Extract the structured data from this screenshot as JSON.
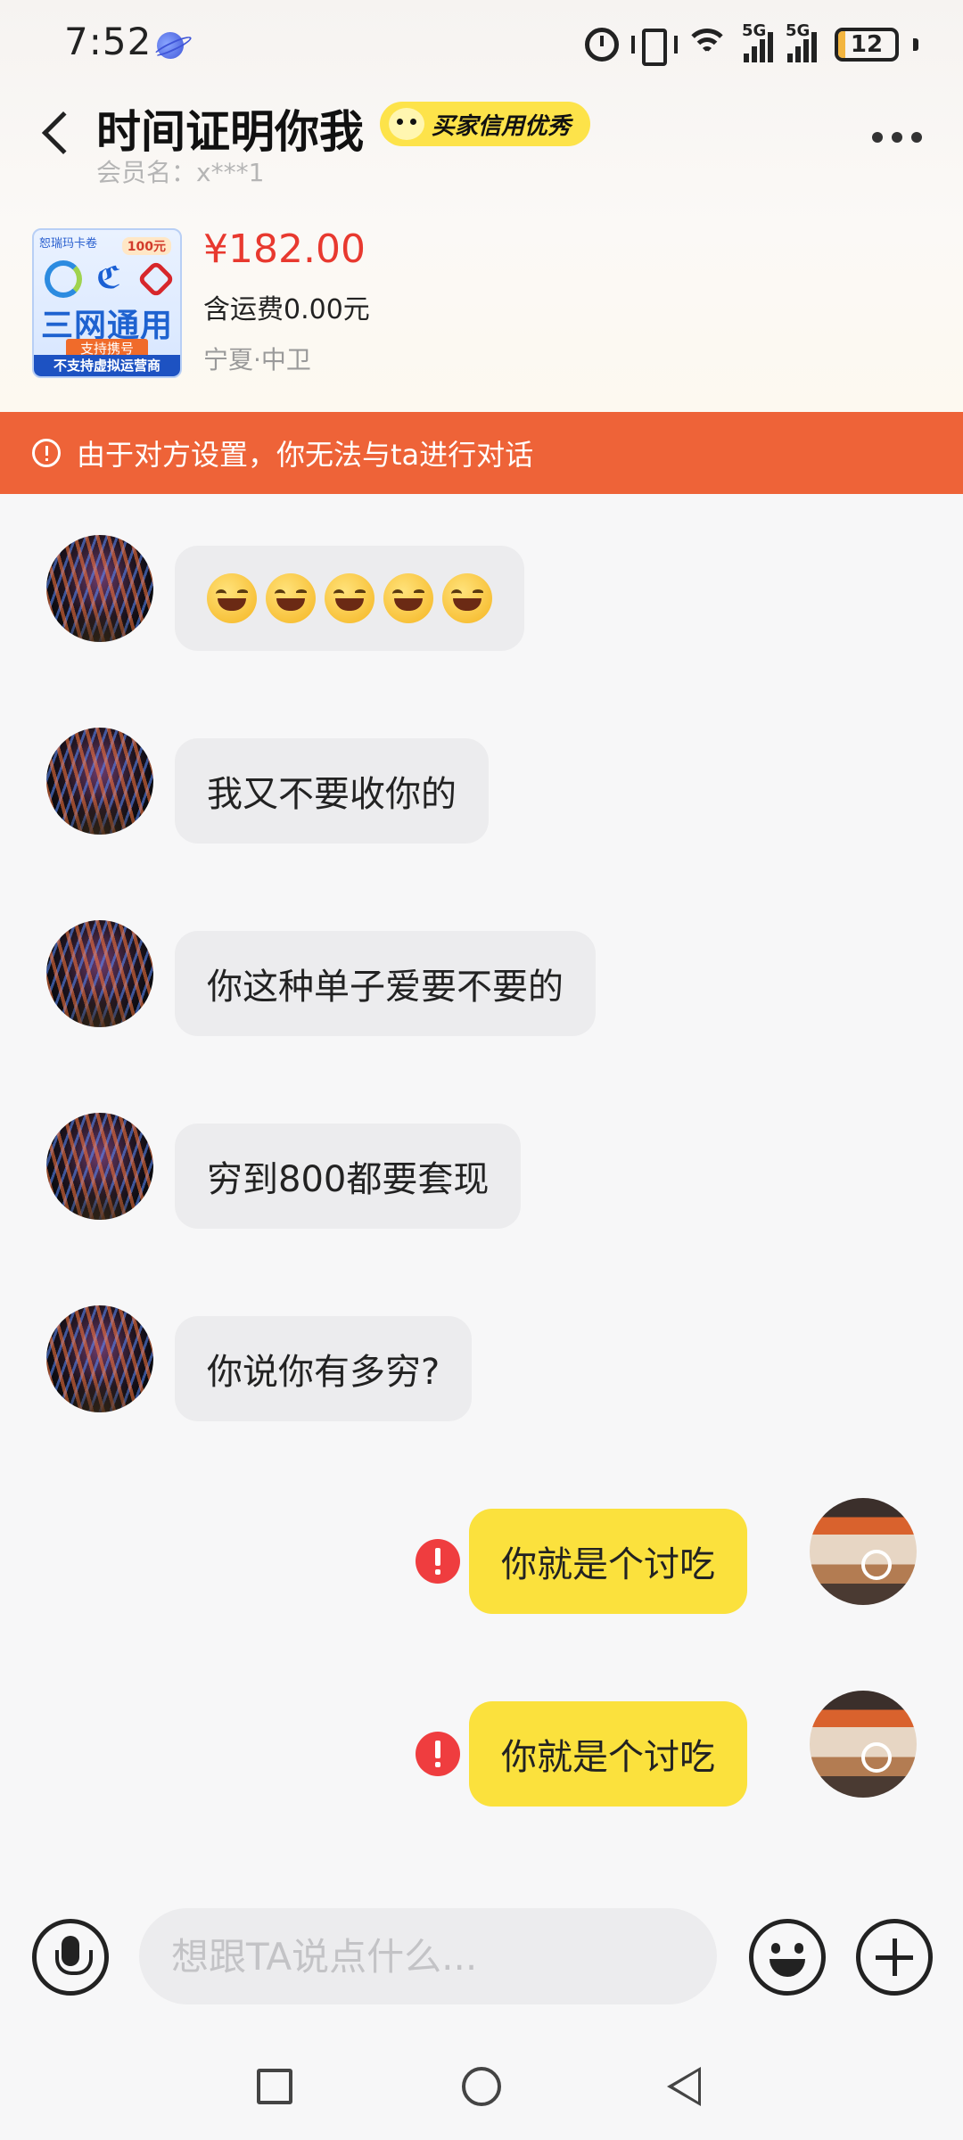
{
  "status_bar": {
    "time": "7:52",
    "signal1_label": "5G",
    "signal2_label": "5G",
    "battery": "12",
    "battery_level": 0.12
  },
  "header": {
    "title": "时间证明你我",
    "badge": "买家信用优秀",
    "member_name": "会员名：x***1"
  },
  "product": {
    "thumb_top": "恕瑞玛卡卷",
    "thumb_badge": "100元",
    "thumb_main": "三网通用",
    "thumb_sub": "支持携号",
    "thumb_bottom": "不支持虚拟运营商",
    "price": "¥182.00",
    "shipping": "含运费0.00元",
    "location": "宁夏·中卫"
  },
  "warning": {
    "text": "由于对方设置，你无法与ta进行对话"
  },
  "messages": [
    {
      "side": "left",
      "type": "emoji",
      "count": 5
    },
    {
      "side": "left",
      "text": "我又不要收你的"
    },
    {
      "side": "left",
      "text": "你这种单子爱要不要的"
    },
    {
      "side": "left",
      "text": "穷到800都要套现"
    },
    {
      "side": "left",
      "text": "你说你有多穷?"
    },
    {
      "side": "right",
      "text": "你就是个讨吃",
      "failed": true
    },
    {
      "side": "right",
      "text": "你就是个讨吃",
      "failed": true
    }
  ],
  "input": {
    "placeholder": "想跟TA说点什么..."
  },
  "icons": {
    "back": "back-arrow-icon",
    "more": "more-icon",
    "mic": "microphone-icon",
    "emoji": "emoji-icon",
    "plus": "plus-icon",
    "warning": "warning-icon",
    "failed": "send-failed-icon"
  },
  "colors": {
    "accent_price": "#e8392f",
    "warning_bar": "#ee6338",
    "own_bubble": "#fbe13d",
    "other_bubble": "#ececee",
    "badge": "#fde34a",
    "failed": "#ef3d3f"
  }
}
